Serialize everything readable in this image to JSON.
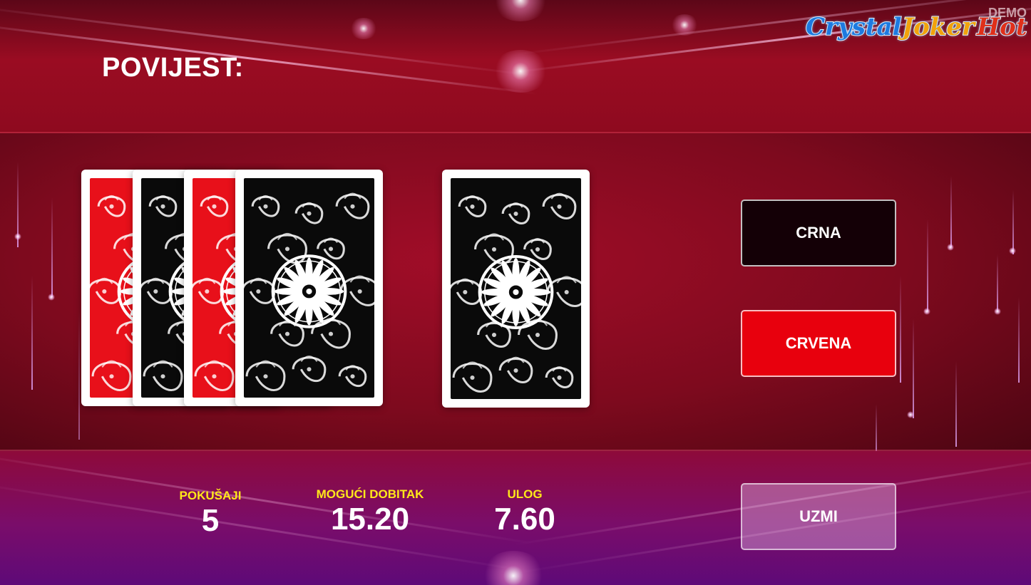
{
  "header": {
    "history_label": "POVIJEST:",
    "demo_label": "DEMO"
  },
  "logo": {
    "word1": "Crystal",
    "word2": "Joker",
    "word3": "Hot"
  },
  "history_cards": [
    {
      "color": "red"
    },
    {
      "color": "black"
    },
    {
      "color": "red"
    },
    {
      "color": "black"
    }
  ],
  "current_card": {
    "state": "face-down",
    "back_color": "black"
  },
  "buttons": {
    "black_label": "CRNA",
    "red_label": "CRVENA",
    "take_label": "UZMI"
  },
  "stats": {
    "attempts_label": "POKUŠAJI",
    "attempts_value": "5",
    "possible_win_label": "MOGUĆI DOBITAK",
    "possible_win_value": "15.20",
    "stake_label": "ULOG",
    "stake_value": "7.60"
  },
  "colors": {
    "red_button": "#e8000d",
    "black_button": "#140006",
    "stat_label": "#ffe81a"
  }
}
